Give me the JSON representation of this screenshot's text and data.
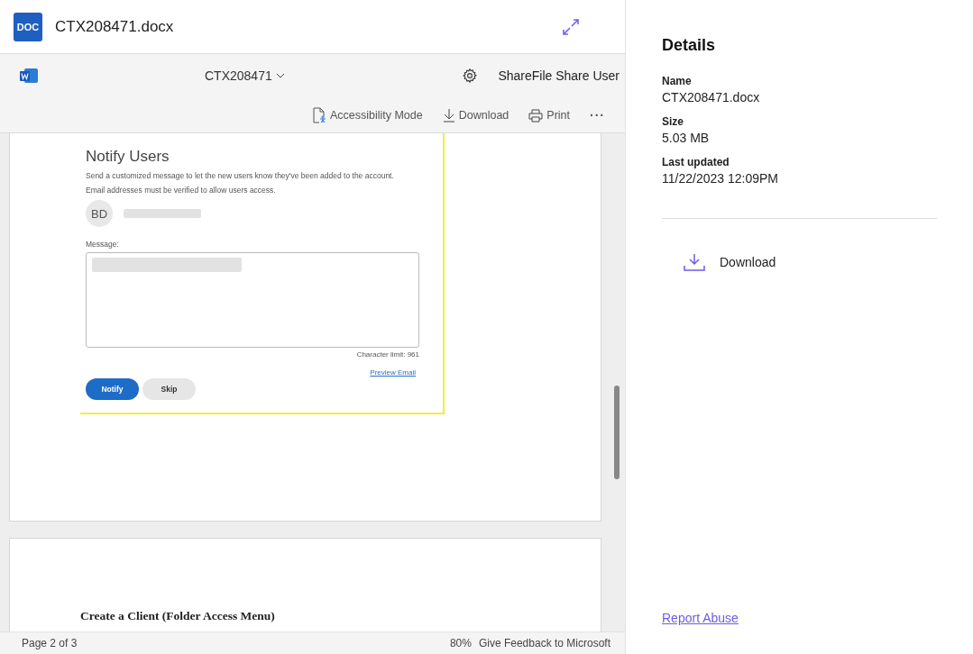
{
  "header": {
    "badge": "DOC",
    "title": "CTX208471.docx"
  },
  "toolbar": {
    "doc_name": "CTX208471",
    "user": "ShareFile Share User",
    "actions": [
      {
        "kind": "accessibility",
        "label": "Accessibility Mode"
      },
      {
        "kind": "download",
        "label": "Download"
      },
      {
        "kind": "print",
        "label": "Print"
      },
      {
        "kind": "more",
        "label": "···"
      }
    ]
  },
  "page1": {
    "title": "Notify Users",
    "lines": [
      "Send a customized message to let the new users know they've been added to the account.",
      "Email addresses must be verified to allow users access."
    ],
    "avatar": "BD",
    "message_label": "Message:",
    "char_limit": "Character limit: 961",
    "preview_link": "Preview Email",
    "buttons": [
      {
        "label": "Notify",
        "selected": true
      },
      {
        "label": "Skip",
        "selected": false
      }
    ]
  },
  "page2": {
    "heading": "Create a Client (Folder Access Menu)"
  },
  "status_bar": {
    "page": "Page 2 of 3",
    "zoom": "80%",
    "feedback": "Give Feedback to Microsoft"
  },
  "details": {
    "title": "Details",
    "fields": [
      {
        "label": "Name",
        "value": "CTX208471.docx"
      },
      {
        "label": "Size",
        "value": "5.03 MB"
      },
      {
        "label": "Last updated",
        "value": "11/22/2023 12:09PM"
      }
    ],
    "download": "Download",
    "report": "Report Abuse"
  }
}
